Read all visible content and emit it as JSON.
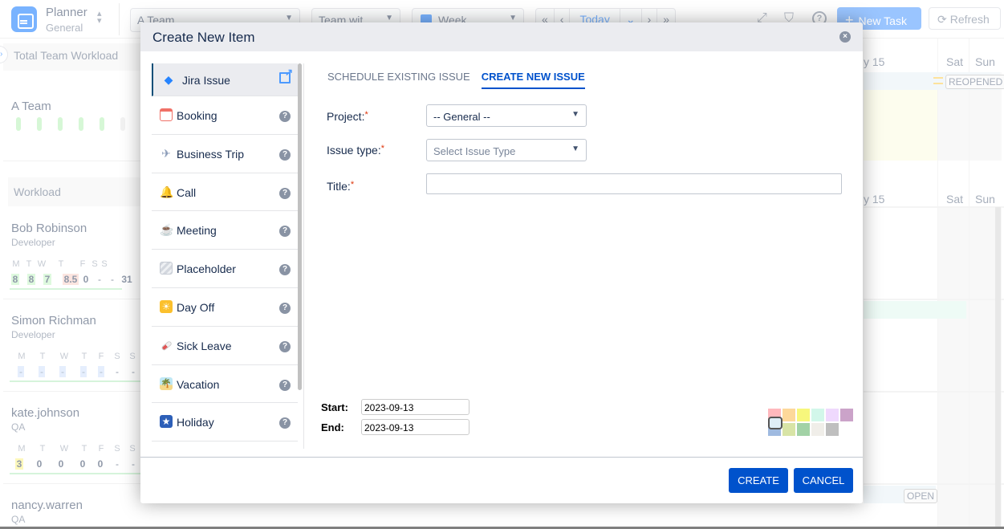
{
  "app": {
    "title": "Planner",
    "subtitle": "General",
    "switcher_glyph": "⌃⌄",
    "team_select": "A Team",
    "filter_select": "Team wit",
    "view_select": "Week",
    "nav": {
      "first": "«",
      "prev": "‹",
      "today": "Today",
      "today_menu": "⌄",
      "next": "›",
      "last": "»"
    },
    "icons": {
      "expand": "⤢",
      "filter": "⛉",
      "help": "?"
    },
    "new_task_label": "New Task",
    "new_task_icon": "+",
    "refresh_label": "Refresh",
    "refresh_icon": "⟳"
  },
  "sidebar": {
    "total_team_workload": "Total Team Workload",
    "toggle_glyph": "›",
    "team_name": "A Team",
    "workload_label": "Workload",
    "people": [
      {
        "name": "Bob Robinson",
        "role": "Developer",
        "days": [
          "M",
          "T",
          "W",
          "T",
          "F",
          "S",
          "S"
        ],
        "values": [
          "8",
          "8",
          "7",
          "8.5",
          "0",
          "-",
          "-"
        ],
        "extra": "31"
      },
      {
        "name": "Simon Richman",
        "role": "Developer",
        "days": [
          "M",
          "T",
          "W",
          "T",
          "F",
          "S",
          "S"
        ],
        "values": [
          "-",
          "-",
          "-",
          "-",
          "-",
          "-",
          "-"
        ]
      },
      {
        "name": "kate.johnson",
        "role": "QA",
        "days": [
          "M",
          "T",
          "W",
          "T",
          "F",
          "S",
          "S"
        ],
        "values": [
          "3",
          "0",
          "0",
          "0",
          "0",
          "-",
          "-"
        ]
      },
      {
        "name": "nancy.warren",
        "role": "QA"
      }
    ]
  },
  "calendar": {
    "header_partial": "y 15",
    "sat": "Sat",
    "sun": "Sun",
    "badges": {
      "reopened": "REOPENED",
      "open": "OPEN"
    }
  },
  "modal": {
    "title": "Create New Item",
    "close_glyph": "×",
    "types": [
      {
        "label": "Jira Issue",
        "icon": "◆",
        "icon_color": "#2684ff",
        "icon_bg": "transparent",
        "active": true
      },
      {
        "label": "Booking",
        "icon": "▭",
        "icon_color": "#f07167",
        "icon_bg": "#fff"
      },
      {
        "label": "Business Trip",
        "icon": "✈",
        "icon_color": "#8a9bb8",
        "icon_bg": "transparent"
      },
      {
        "label": "Call",
        "icon": "🔔",
        "icon_color": "#e0a82e",
        "icon_bg": "transparent"
      },
      {
        "label": "Meeting",
        "icon": "☕",
        "icon_color": "#8b5a3c",
        "icon_bg": "transparent"
      },
      {
        "label": "Placeholder",
        "icon": "▨",
        "icon_color": "#b3bac5",
        "icon_bg": "#e4e6ea"
      },
      {
        "label": "Day Off",
        "icon": "☀",
        "icon_color": "#fff",
        "icon_bg": "#fbc02d"
      },
      {
        "label": "Sick Leave",
        "icon": "💊",
        "icon_color": "#e05555",
        "icon_bg": "transparent"
      },
      {
        "label": "Vacation",
        "icon": "🌴",
        "icon_color": "#2e9e4f",
        "icon_bg": "#bfe8f5"
      },
      {
        "label": "Holiday",
        "icon": "★",
        "icon_color": "#fff",
        "icon_bg": "#2d5fb8"
      }
    ],
    "help_glyph": "?",
    "tabs": [
      {
        "label": "SCHEDULE EXISTING ISSUE",
        "active": false
      },
      {
        "label": "CREATE NEW ISSUE",
        "active": true
      }
    ],
    "form": {
      "project_label": "Project:",
      "project_value": "-- General --",
      "issue_type_label": "Issue type:",
      "issue_type_placeholder": "Select Issue Type",
      "title_label": "Title:",
      "title_value": "",
      "required_mark": "*",
      "start_label": "Start:",
      "start_value": "2023-09-13",
      "end_label": "End:",
      "end_value": "2023-09-13",
      "chevron": "⌄"
    },
    "palette": {
      "colors": [
        "#ffb8bd",
        "#fdd89a",
        "#f7f77c",
        "#d2f7ea",
        "#deedf6",
        "#efd9fd",
        "#cba3c9",
        "#9fbae0",
        "#d8e4a6",
        "#a2d2a6",
        "#f0eee9",
        "#bfbfbf"
      ],
      "selected_index": 4
    },
    "buttons": {
      "create": "CREATE",
      "cancel": "CANCEL"
    }
  }
}
